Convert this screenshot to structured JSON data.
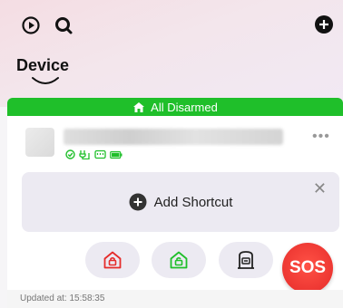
{
  "header": {
    "title": "Device",
    "icons": {
      "history": "history-icon",
      "search": "search-icon",
      "add": "add-icon"
    }
  },
  "status": {
    "label": "All Disarmed",
    "icon": "home-icon",
    "color": "#1fbf2a"
  },
  "device": {
    "status_icons": [
      "online-check-icon",
      "power-plug-icon",
      "network-icon",
      "battery-icon"
    ],
    "more_label": "•••"
  },
  "shortcut": {
    "label": "Add Shortcut",
    "close_label": "✕"
  },
  "modes": [
    {
      "name": "arm-away-icon",
      "color": "#e52b2a"
    },
    {
      "name": "arm-home-icon",
      "color": "#1fbf2a"
    },
    {
      "name": "disarm-icon",
      "color": "#222222"
    }
  ],
  "sos": {
    "label": "SOS",
    "color": "#e52b2a"
  },
  "footer": {
    "updated": "Updated at: 15:58:35"
  }
}
